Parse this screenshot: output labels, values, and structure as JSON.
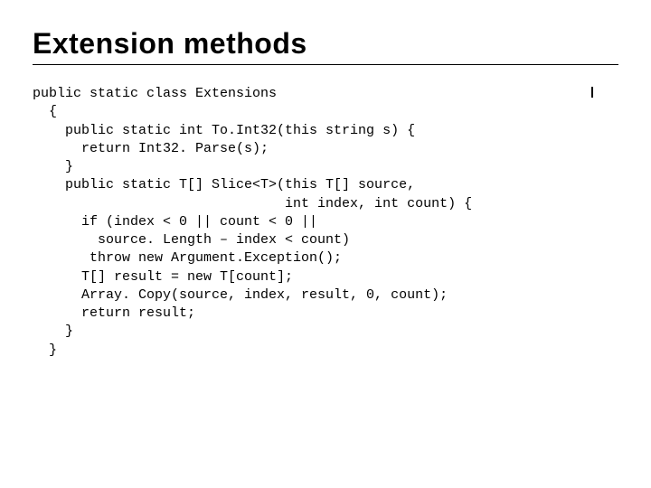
{
  "title": "Extension methods",
  "code": "public static class Extensions\n  {\n    public static int To.Int32(this string s) {\n      return Int32. Parse(s);\n    }\n    public static T[] Slice<T>(this T[] source,\n                               int index, int count) {\n      if (index < 0 || count < 0 ||\n        source. Length – index < count)\n       throw new Argument.Exception();\n      T[] result = new T[count];\n      Array. Copy(source, index, result, 0, count);\n      return result;\n    }\n  }"
}
